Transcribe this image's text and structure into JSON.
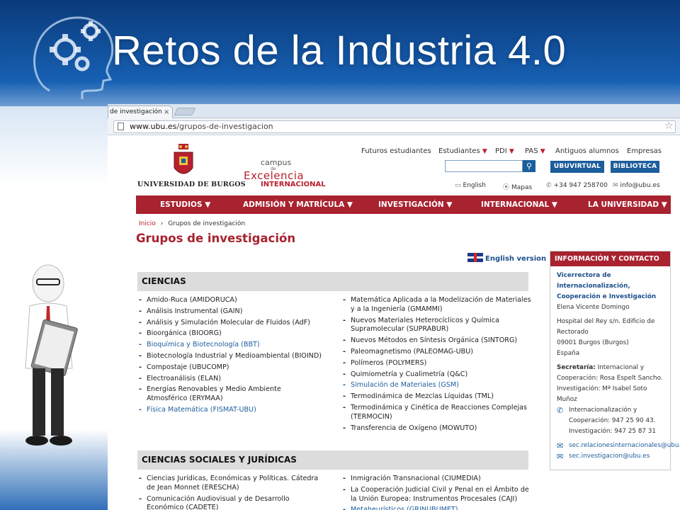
{
  "slide": {
    "title": "Retos de la Industria 4.0"
  },
  "browser": {
    "tab_title": "de investigación",
    "tab_close": "×",
    "url_domain": "www.ubu.es",
    "url_path": "/grupos-de-investigacion"
  },
  "site": {
    "university_name": "UNIVERSIDAD DE BURGOS",
    "campus": {
      "line1": "campus",
      "line2": "de",
      "line3": "Excelencia",
      "line4": "INTERNACIONAL"
    },
    "top_links": [
      {
        "label": "Futuros estudiantes",
        "arrow": ""
      },
      {
        "label": "Estudiantes",
        "arrow": "▼"
      },
      {
        "label": "PDI",
        "arrow": "▼"
      },
      {
        "label": "PAS",
        "arrow": "▼"
      },
      {
        "label": "Antiguos alumnos",
        "arrow": ""
      },
      {
        "label": "Empresas",
        "arrow": ""
      }
    ],
    "search_placeholder": "",
    "buttons": {
      "ubuvirtual": "UBUVIRTUAL",
      "biblioteca": "BIBLIOTECA"
    },
    "utility": {
      "english": "English",
      "mapas": "Mapas",
      "phone": "+34 947 258700",
      "email": "info@ubu.es"
    },
    "main_nav": [
      "ESTUDIOS ▼",
      "ADMISIÓN Y MATRÍCULA ▼",
      "INVESTIGACIÓN ▼",
      "INTERNACIONAL ▼",
      "LA UNIVERSIDAD ▼"
    ],
    "breadcrumb": {
      "home": "Inicio",
      "sep": "›",
      "current": "Grupos de investigación"
    },
    "page_title": "Grupos de investigación",
    "english_version": "English version",
    "sections": [
      {
        "title": "CIENCIAS",
        "left": [
          {
            "text": "Amido-Ruca (AMIDORUCA)",
            "link": false
          },
          {
            "text": "Análisis Instrumental (GAIN)",
            "link": false
          },
          {
            "text": "Análisis y Simulación Molecular de Fluidos (AdF)",
            "link": false
          },
          {
            "text": "Bioorgánica (BIOORG)",
            "link": false
          },
          {
            "text": "Bioquímica y Biotecnología (BBT)",
            "link": true
          },
          {
            "text": "Biotecnología Industrial y Medioambiental (BIOIND)",
            "link": false
          },
          {
            "text": "Compostaje (UBUCOMP)",
            "link": false
          },
          {
            "text": "Electroanálisis (ELAN)",
            "link": false
          },
          {
            "text": "Energías Renovables y Medio Ambiente Atmosférico (ERYMAA)",
            "link": false
          },
          {
            "text": "Física Matemática (FISMAT-UBU)",
            "link": true
          }
        ],
        "right": [
          {
            "text": "Matemática Aplicada a la Modelización de Materiales y a la Ingeniería (GMAMMI)",
            "link": false
          },
          {
            "text": "Nuevos Materiales Heterocíclicos y Química Supramolecular (SUPRABUR)",
            "link": false
          },
          {
            "text": "Nuevos Métodos en Síntesis Orgánica (SINTORG)",
            "link": false
          },
          {
            "text": "Paleomagnetismo (PALEOMAG-UBU)",
            "link": false
          },
          {
            "text": "Polímeros (POLYMERS)",
            "link": false
          },
          {
            "text": "Quimiometría y Cualimetría (Q&C)",
            "link": false
          },
          {
            "text": "Simulación de Materiales (GSM)",
            "link": true
          },
          {
            "text": "Termodinámica de Mezclas Líquidas (TML)",
            "link": false
          },
          {
            "text": "Termodinámica y Cinética de Reacciones Complejas (TERMOCIN)",
            "link": false
          },
          {
            "text": "Transferencia de Oxígeno (MOWUTO)",
            "link": false
          }
        ]
      },
      {
        "title": "CIENCIAS SOCIALES Y JURÍDICAS",
        "left": [
          {
            "text": "Ciencias Jurídicas, Económicas y Políticas. Cátedra de Jean Monnet (ERESCHA)",
            "link": false
          },
          {
            "text": "Comunicación Audiovisual y de Desarrollo Económico (CADETE)",
            "link": false
          }
        ],
        "right": [
          {
            "text": "Inmigración Transnacional (CIUMEDIA)",
            "link": false
          },
          {
            "text": "La Cooperación Judicial Civil y Penal en el Ámbito de la Unión Europea: Instrumentos Procesales (CAJI)",
            "link": false
          },
          {
            "text": "Metaheurísticos (GRINUBUMET)",
            "link": true
          }
        ]
      }
    ],
    "sidebar": {
      "title": "INFORMACIÓN Y CONTACTO",
      "org": "Vicerrectora de Internacionalización, Cooperación e Investigación",
      "person": "Elena Vicente Domingo",
      "address": "Hospital del Rey s/n. Edificio de Rectorado",
      "city": "09001 Burgos (Burgos)",
      "country": "España",
      "secretaria_label": "Secretaría:",
      "secretaria_text": "Internacional y Cooperación: Rosa Espelt Sancho. Investigación: Mª Isabel Soto Muñoz",
      "phones": "Internacionalización y Cooperación: 947 25 90 43. Investigación: 947 25 87 31",
      "email1": "sec.relacionesinternacionales@ubu.es",
      "email2": "sec.investigacion@ubu.es"
    }
  }
}
